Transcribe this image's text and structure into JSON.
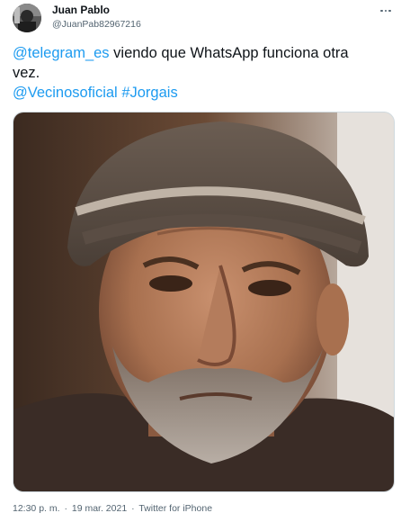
{
  "user": {
    "display_name": "Juan Pablo",
    "handle": "@JuanPab82967216"
  },
  "tweet": {
    "mention_1": "@telegram_es",
    "text_1": " viendo que WhatsApp funciona otra",
    "text_2": "vez.",
    "mention_2": "@Vecinosoficial",
    "hashtag": "#Jorgais"
  },
  "meta": {
    "time": "12:30 p. m.",
    "separator_1": "·",
    "date": "19 mar. 2021",
    "separator_2": "·",
    "source": "Twitter for iPhone"
  },
  "colors": {
    "link": "#1d9bf0",
    "text": "#0f1419",
    "secondary": "#536471"
  },
  "icons": {
    "more": "more-dots-icon",
    "avatar": "avatar"
  }
}
